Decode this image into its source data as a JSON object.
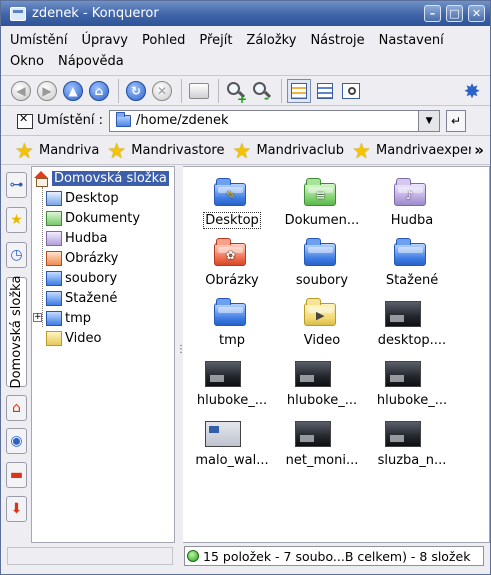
{
  "window": {
    "title": "zdenek - Konqueror"
  },
  "menu": [
    {
      "label": "Umístění"
    },
    {
      "label": "Úpravy"
    },
    {
      "label": "Pohled"
    },
    {
      "label": "Přejít"
    },
    {
      "label": "Záložky"
    },
    {
      "label": "Nástroje"
    },
    {
      "label": "Nastavení"
    },
    {
      "label": "Okno"
    },
    {
      "label": "Nápověda"
    }
  ],
  "toolbar": {
    "buttons": [
      "back-icon",
      "forward-icon",
      "up-icon",
      "home-icon",
      "reload-icon",
      "stop-icon",
      "print-icon",
      "zoom-in-icon",
      "zoom-out-icon",
      "icon-view-icon",
      "tree-view-icon",
      "find-icon",
      "settings-gear-icon"
    ]
  },
  "location": {
    "label": "Umístění :",
    "value": "/home/zdenek"
  },
  "bookmarks": [
    {
      "label": "Mandriva"
    },
    {
      "label": "Mandrivastore"
    },
    {
      "label": "Mandrivaclub"
    },
    {
      "label": "Mandrivaexpert"
    }
  ],
  "sidebar": {
    "vertical_tab": "Domovská složka"
  },
  "tree": {
    "root": "Domovská složka",
    "items": [
      {
        "label": "Desktop"
      },
      {
        "label": "Dokumenty"
      },
      {
        "label": "Hudba"
      },
      {
        "label": "Obrázky"
      },
      {
        "label": "soubory"
      },
      {
        "label": "Stažené"
      },
      {
        "label": "tmp"
      },
      {
        "label": "Video"
      }
    ]
  },
  "files": [
    {
      "label": "Desktop",
      "icon": "desktop-folder"
    },
    {
      "label": "Dokumen...",
      "icon": "documents-folder"
    },
    {
      "label": "Hudba",
      "icon": "music-folder"
    },
    {
      "label": "Obrázky",
      "icon": "pictures-folder"
    },
    {
      "label": "soubory",
      "icon": "folder"
    },
    {
      "label": "Stažené",
      "icon": "folder"
    },
    {
      "label": "tmp",
      "icon": "folder"
    },
    {
      "label": "Video",
      "icon": "video-folder"
    },
    {
      "label": "desktop....",
      "icon": "image-thumbnail"
    },
    {
      "label": "hluboke_...",
      "icon": "image-thumbnail"
    },
    {
      "label": "hluboke_...",
      "icon": "image-thumbnail"
    },
    {
      "label": "hluboke_...",
      "icon": "image-thumbnail"
    },
    {
      "label": "malo_wal...",
      "icon": "image-thumbnail"
    },
    {
      "label": "net_moni...",
      "icon": "image-thumbnail"
    },
    {
      "label": "sluzba_n...",
      "icon": "image-thumbnail"
    }
  ],
  "status": {
    "text": "15 položek - 7 soubo...B celkem) - 8 složek"
  }
}
